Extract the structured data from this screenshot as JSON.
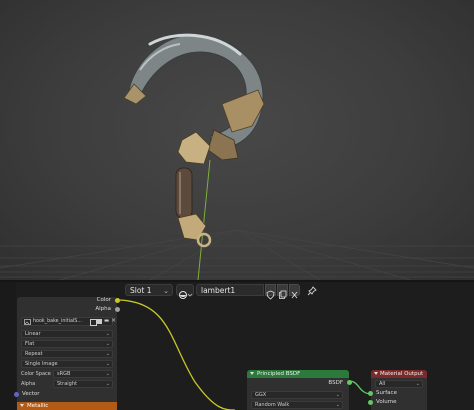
{
  "header": {
    "slot_label": "Slot 1",
    "material_name": "lambert1"
  },
  "image_node": {
    "outputs": [
      "Color",
      "Alpha"
    ],
    "image_name": "hook_bake_initialS...",
    "interpolation": "Linear",
    "projection": "Flat",
    "extension": "Repeat",
    "source": "Single Image",
    "color_space_label": "Color Space",
    "color_space_value": "sRGB",
    "alpha_label": "Alpha",
    "alpha_value": "Straight",
    "vector_label": "Vector"
  },
  "metallic_node": {
    "title": "Metallic"
  },
  "bsdf_node": {
    "title": "Principled BSDF",
    "output_label": "BSDF",
    "distribution": "GGX",
    "subsurface_method": "Random Walk"
  },
  "output_node": {
    "title": "Material Output",
    "target": "All",
    "inputs": [
      "Surface",
      "Volume"
    ]
  },
  "colors": {
    "socket_color": "#c7c729",
    "socket_shader": "#63c763",
    "socket_vector": "#6363c7",
    "bsdf_header": "#2b7a3b",
    "output_header": "#7a2a2a",
    "metallic_header": "#b35a14"
  }
}
